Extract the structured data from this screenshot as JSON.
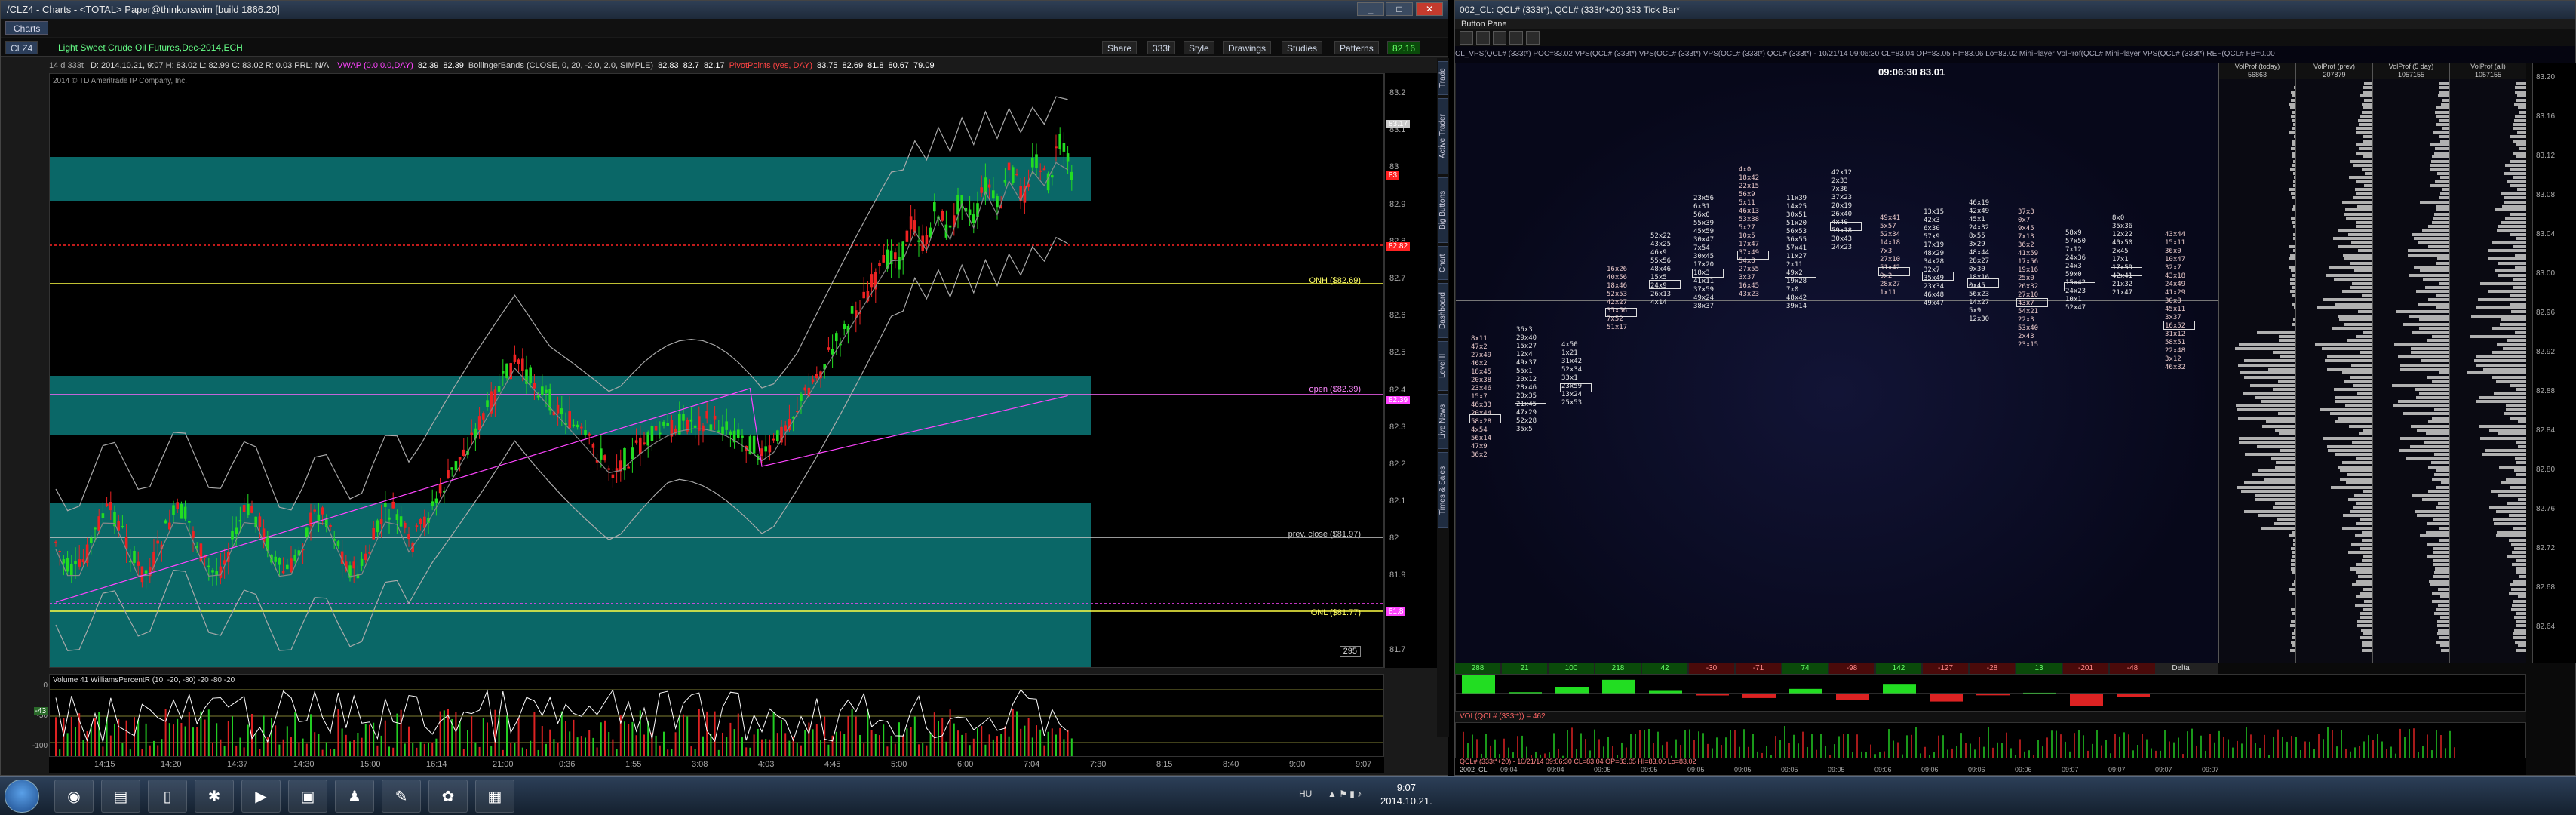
{
  "left_window": {
    "title": "/CLZ4 - Charts - <TOTAL> Paper@thinkorswim [build 1866.20]",
    "tab": "Charts",
    "symbol": "CLZ4",
    "symbol_desc": "Light Sweet Crude Oil Futures,Dec-2014,ECH",
    "symbol_ext": "14 d 333t",
    "ohlc": "D: 2014.10.21, 9:07  H: 83.02  L: 82.99  C: 83.02  R: 0.03  PRL: N/A",
    "tool_share": "Share",
    "tool_style": "Style",
    "tool_drawings": "Drawings",
    "tool_studies": "Studies",
    "tool_patterns": "Patterns",
    "tool_ticks": "333t",
    "last_price": "82.16",
    "studies": [
      {
        "text": "VWAP (0.0,0.0,DAY)",
        "color": "#ff44ff"
      },
      {
        "text": "82.39",
        "color": "#ffffff"
      },
      {
        "text": "82.39",
        "color": "#ffffff"
      },
      {
        "text": "BollingerBands (CLOSE, 0, 20, -2.0, 2.0, SIMPLE)",
        "color": "#cfcfcf"
      },
      {
        "text": "82.83",
        "color": "#ffffff"
      },
      {
        "text": "82.7",
        "color": "#ffffff"
      },
      {
        "text": "82.17",
        "color": "#ffffff"
      },
      {
        "text": "PivotPoints (yes, DAY)",
        "color": "#ff4444"
      },
      {
        "text": "83.75",
        "color": "#ffffff"
      },
      {
        "text": "82.69",
        "color": "#ffffff"
      },
      {
        "text": "81.8",
        "color": "#ffffff"
      },
      {
        "text": "80.67",
        "color": "#ffffff"
      },
      {
        "text": "79.09",
        "color": "#ffffff"
      }
    ],
    "copyright": "2014 © TD Ameritrade IP Company, Inc.",
    "y_labels": [
      "83.2",
      "83.1",
      "83",
      "82.9",
      "82.8",
      "82.7",
      "82.6",
      "82.5",
      "82.4",
      "82.3",
      "82.2",
      "82.1",
      "82",
      "81.9",
      "81.8",
      "81.7"
    ],
    "levels": {
      "onh": "ONH ($82.69)",
      "open": "open ($82.39)",
      "prev_close": "prev. close ($81.97)",
      "onl": "ONL ($81.77)"
    },
    "price_tags": [
      {
        "text": "83.17",
        "color": "#cccccc"
      },
      {
        "text": "83",
        "color": "#ff2222"
      },
      {
        "text": "82.82",
        "color": "#ff2222"
      },
      {
        "text": "82.39",
        "color": "#ff44ff"
      },
      {
        "text": "81.8",
        "color": "#ff44ff"
      }
    ],
    "bar_count": "295",
    "lower_study": "Volume  41  WilliamsPercentR (10, -20, -80)  -20  -80  -20",
    "lower_y": [
      "0",
      "-50",
      "-100"
    ],
    "lower_tag": "-43",
    "x_labels": [
      "14:15",
      "14:20",
      "14:37",
      "14:30",
      "15:00",
      "16:14",
      "21:00",
      "0:36",
      "1:55",
      "3:08",
      "4:03",
      "4:45",
      "5:00",
      "6:00",
      "7:04",
      "7:30",
      "8:15",
      "8:40",
      "9:00",
      "9:07"
    ],
    "side_tabs": [
      "Trade",
      "Active Trader",
      "Big Buttons",
      "Chart",
      "Dashboard",
      "Level II",
      "Live News",
      "Times & Sales"
    ]
  },
  "right_window": {
    "title": "002_CL: QCL# (333t*), QCL# (333t*+20) 333 Tick Bar*",
    "button_pane": "Button Pane",
    "header": "CL_VPS(QCL# (333t*) POC=83.02   VPS(QCL# (333t*)   VPS(QCL# (333t*)   VPS(QCL# (333t*)   QCL# (333t*) - 10/21/14 09:06:30 CL=83.04 OP=83.05 HI=83.06 Lo=83.02   MiniPlayer   VolProf(QCL#   MiniPlayer   VPS(QCL# (333t*)   REF(QCL# FB=0.00",
    "time_price": "09:06:30  83.01",
    "vp_heads": [
      {
        "name": "VolProf (today)",
        "val": "56863"
      },
      {
        "name": "VolProf (prev)",
        "val": "207879"
      },
      {
        "name": "VolProf (5 day)",
        "val": "1057155"
      },
      {
        "name": "VolProf (all)",
        "val": "1057155"
      }
    ],
    "y_labels": [
      "83.20",
      "83.16",
      "83.12",
      "83.08",
      "83.04",
      "83.00",
      "82.96",
      "82.92",
      "82.88",
      "82.84",
      "82.80",
      "82.76",
      "82.72",
      "82.68",
      "82.64"
    ],
    "deltas": [
      "288",
      "21",
      "100",
      "218",
      "42",
      "-30",
      "-71",
      "74",
      "-98",
      "142",
      "-127",
      "-28",
      "13",
      "-201",
      "-48"
    ],
    "delta_label": "Delta",
    "vol_header": "VOL(QCL# (333t*)) = 462",
    "bottom_header": "QCL# (333t*+20) - 10/21/14 09:06:30 CL=83.04 OP=83.05 HI=83.06 Lo=83.02",
    "x_labels": [
      "09:04",
      "09:04",
      "09:05",
      "09:05",
      "09:05",
      "09:05",
      "09:05",
      "09:05",
      "09:06",
      "09:06",
      "09:06",
      "09:06",
      "09:07",
      "09:07",
      "09:07",
      "09:07"
    ],
    "x_start": "2002_CL"
  },
  "taskbar": {
    "lang": "HU",
    "time": "9:07",
    "date": "2014.10.21."
  }
}
